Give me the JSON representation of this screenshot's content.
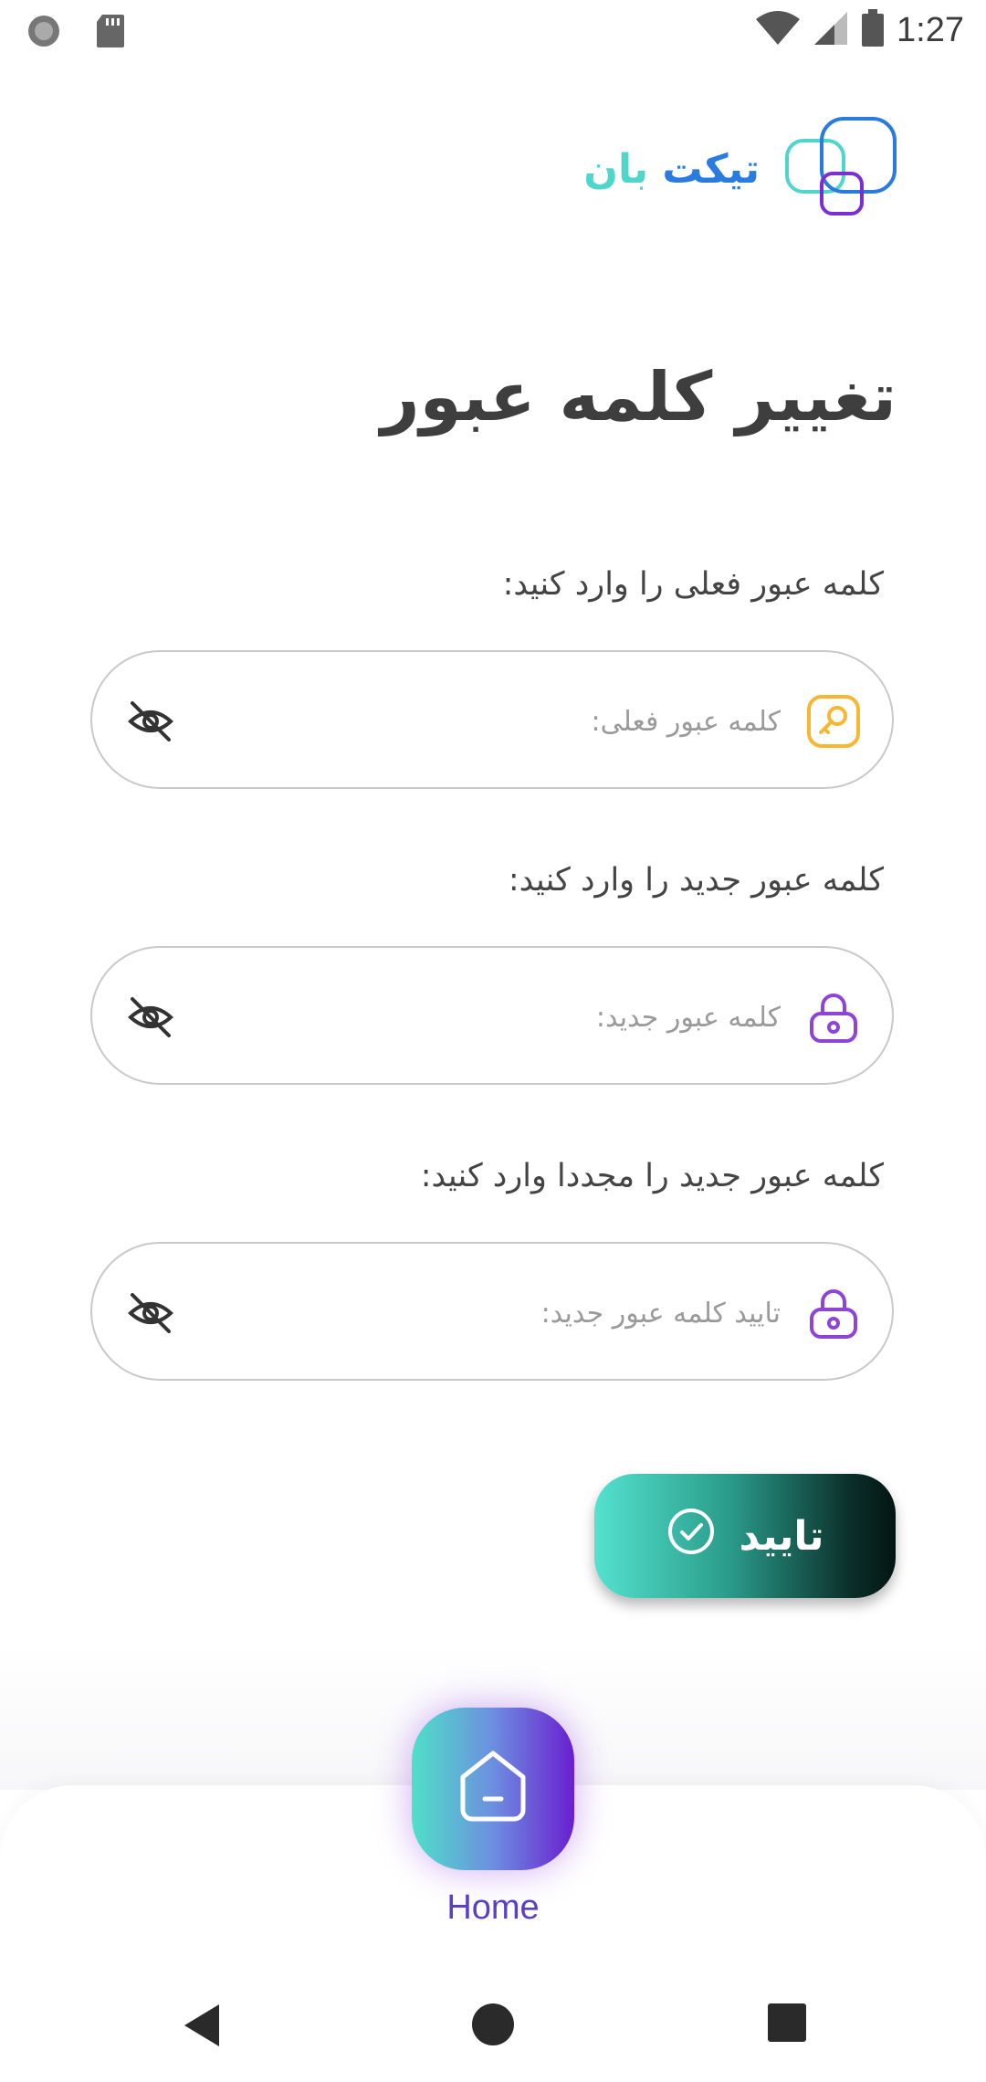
{
  "status_bar": {
    "time": "1:27",
    "left_icons": [
      "record-icon",
      "sd-card-icon"
    ],
    "right_icons": [
      "wifi-icon",
      "signal-icon",
      "battery-icon"
    ]
  },
  "app": {
    "logo_text_primary": "تیکت",
    "logo_text_secondary": "بان"
  },
  "page": {
    "title": "تغییر کلمه عبور"
  },
  "form": {
    "current_password": {
      "label": "کلمه عبور فعلی را وارد کنید:",
      "placeholder": "کلمه عبور فعلی:",
      "value": "",
      "icon": "key-icon",
      "icon_color": "#f7b731"
    },
    "new_password": {
      "label": "کلمه عبور جدید را وارد کنید:",
      "placeholder": "کلمه عبور جدید:",
      "value": "",
      "icon": "lock-icon",
      "icon_color": "#8e44d6"
    },
    "confirm_password": {
      "label": "کلمه عبور جدید را مجددا وارد کنید:",
      "placeholder": "تایید کلمه عبور جدید:",
      "value": "",
      "icon": "lock-icon",
      "icon_color": "#8e44d6"
    },
    "submit_label": "تایید"
  },
  "bottom_nav": {
    "home_label": "Home",
    "home_color": "#5b3fc9"
  },
  "colors": {
    "logo_blue": "#2a7be0",
    "logo_teal": "#4fd6cb",
    "button_gradient_start": "#54e2cf",
    "button_gradient_end": "#031512"
  }
}
